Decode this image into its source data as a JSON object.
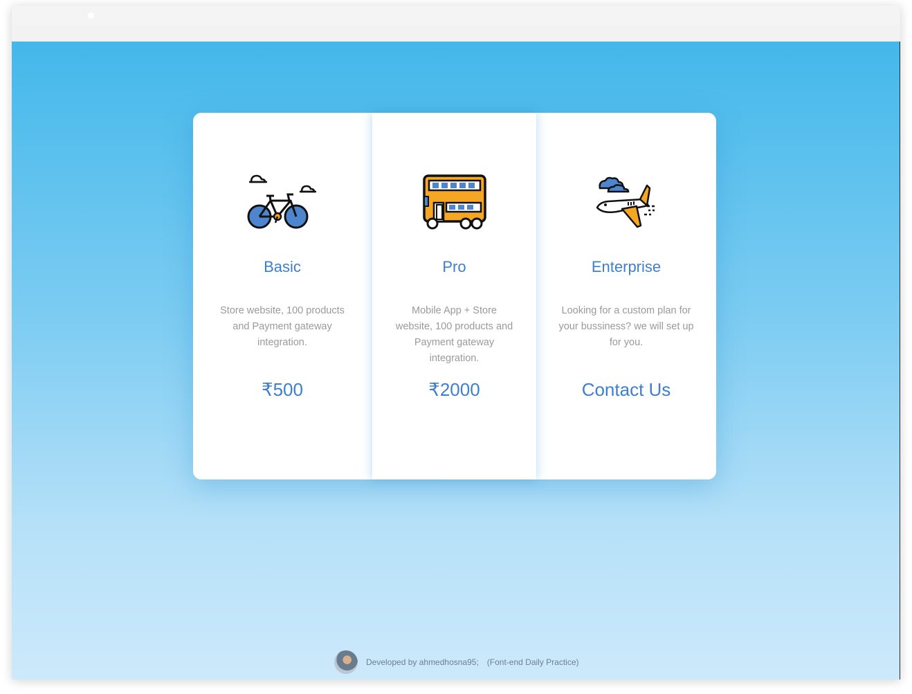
{
  "plans": [
    {
      "icon": "bicycle-icon",
      "title": "Basic",
      "description": "Store website, 100 products and Payment gateway integration.",
      "price": "₹500"
    },
    {
      "icon": "double-decker-bus-icon",
      "title": "Pro",
      "description": "Mobile App + Store website, 100 products and Payment gateway integration.",
      "price": "₹2000"
    },
    {
      "icon": "airplane-icon",
      "title": "Enterprise",
      "description": "Looking for a custom plan for your bussiness? we will set up for you.",
      "price": "Contact Us"
    }
  ],
  "footer": {
    "credit": "Developed by ahmedhosna95;",
    "note": "(Font-end Daily Practice)"
  },
  "colors": {
    "accent": "#3d7fce",
    "description": "#9a9a9a",
    "background_top": "#43b8ea",
    "background_bottom": "#cde9fb"
  }
}
